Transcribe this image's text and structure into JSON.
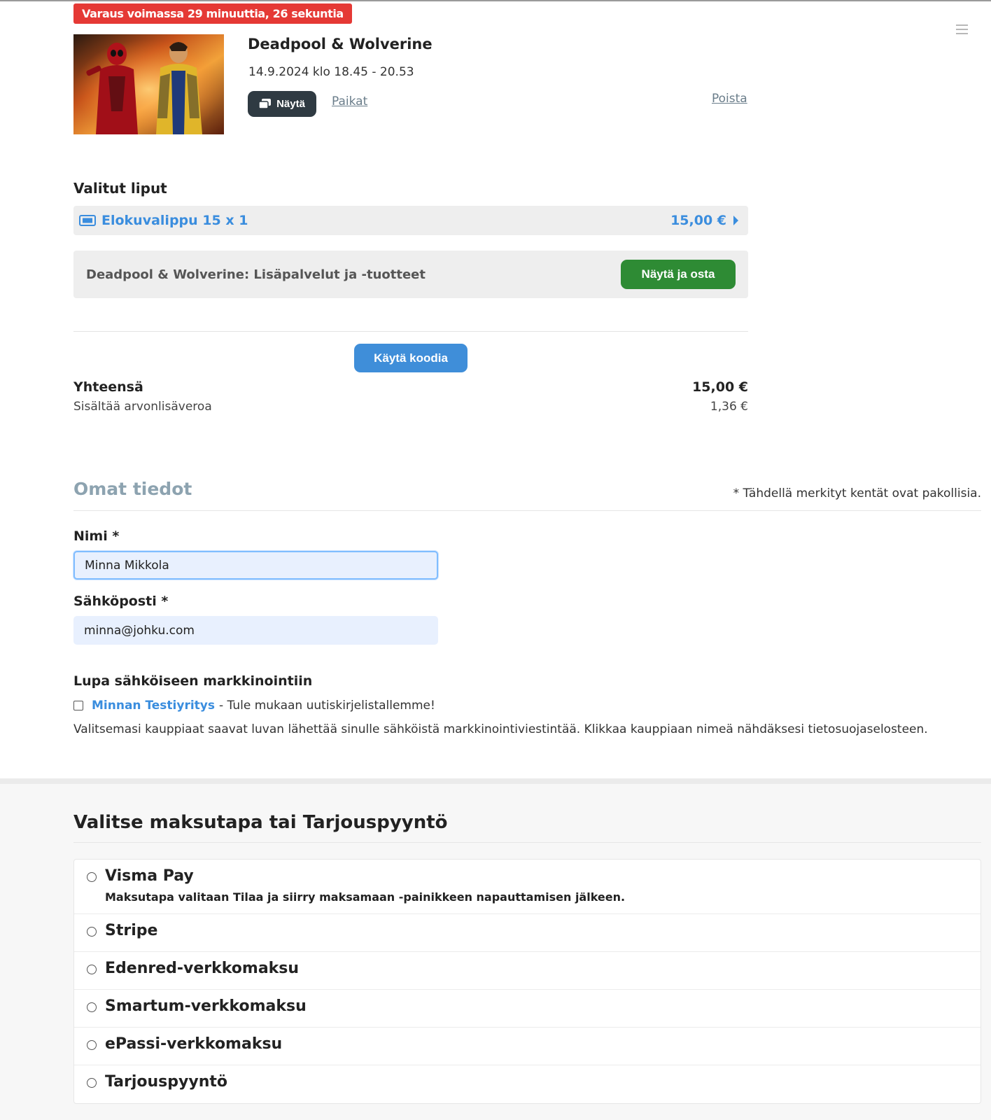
{
  "timer": "Varaus voimassa 29 minuuttia, 26 sekuntia",
  "event": {
    "title": "Deadpool & Wolverine",
    "datetime": "14.9.2024 klo 18.45 - 20.53",
    "show_label": "Näytä",
    "seats_label": "Paikat",
    "remove_label": "Poista"
  },
  "tickets": {
    "heading": "Valitut liput",
    "items": [
      {
        "label": "Elokuvalippu 15 x 1",
        "price": "15,00 €"
      }
    ]
  },
  "extras": {
    "label": "Deadpool & Wolverine: Lisäpalvelut ja -tuotteet",
    "button": "Näytä ja osta"
  },
  "code_button": "Käytä koodia",
  "totals": {
    "label": "Yhteensä",
    "value": "15,00 €",
    "vat_label": "Sisältää arvonlisäveroa",
    "vat_value": "1,36 €"
  },
  "info": {
    "title": "Omat tiedot",
    "required_note": "* Tähdellä merkityt kentät ovat pakollisia.",
    "name_label": "Nimi *",
    "name_value": "Minna Mikkola",
    "email_label": "Sähköposti *",
    "email_value": "minna@johku.com"
  },
  "consent": {
    "heading": "Lupa sähköiseen markkinointiin",
    "merchant": "Minnan Testiyritys",
    "merchant_text": "- Tule mukaan uutiskirjelistallemme!",
    "checked": false,
    "text": "Valitsemasi kauppiaat saavat luvan lähettää sinulle sähköistä markkinointiviestintää. Klikkaa kauppiaan nimeä nähdäksesi tietosuojaselosteen."
  },
  "payment": {
    "title": "Valitse maksutapa tai Tarjouspyyntö",
    "methods": [
      {
        "label": "Visma Pay",
        "description": "Maksutapa valitaan Tilaa ja siirry maksamaan -painikkeen napauttamisen jälkeen."
      },
      {
        "label": "Stripe"
      },
      {
        "label": "Edenred-verkkomaksu"
      },
      {
        "label": "Smartum-verkkomaksu"
      },
      {
        "label": "ePassi-verkkomaksu"
      },
      {
        "label": "Tarjouspyyntö"
      }
    ]
  },
  "colors": {
    "timer_bg": "#e53935",
    "link_blue": "#3a8dde",
    "buy_green": "#2e8b34",
    "code_blue": "#3f8ed9",
    "dark_button": "#2f3a42"
  },
  "icons": {
    "menu": "hamburger-menu-icon",
    "show": "tickets-icon",
    "ticket": "ticket-icon",
    "caret": "caret-right-icon"
  }
}
